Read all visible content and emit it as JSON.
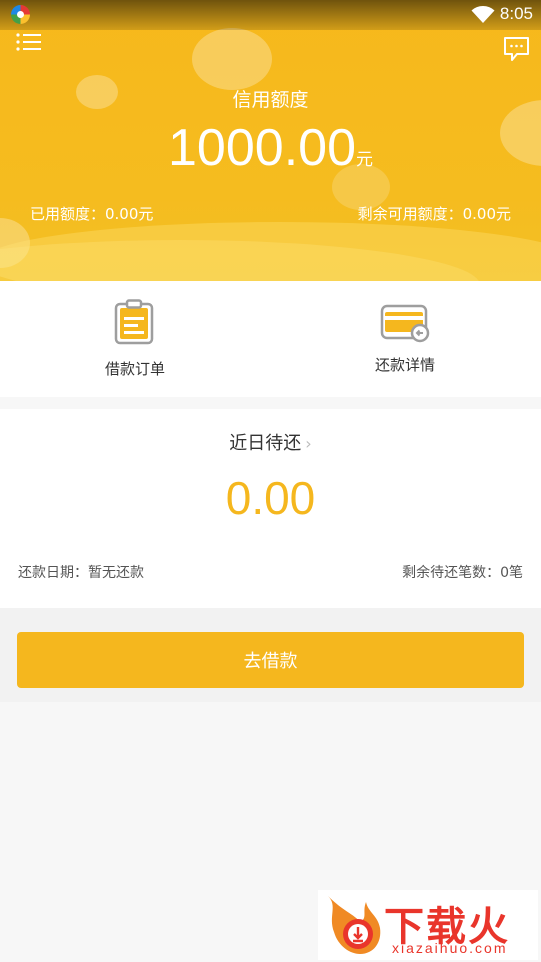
{
  "status_bar": {
    "time": "8:05"
  },
  "header": {
    "credit_label": "信用额度",
    "credit_amount": "1000.00",
    "credit_unit": "元",
    "used_credit": "已用额度：0.00元",
    "remaining_credit": "剩余可用额度：0.00元"
  },
  "actions": [
    {
      "label": "借款订单",
      "icon": "clipboard-icon"
    },
    {
      "label": "还款详情",
      "icon": "card-icon"
    }
  ],
  "repayment": {
    "title": "近日待还",
    "chevron": "›",
    "amount": "0.00",
    "date_text": "还款日期：暂无还款",
    "count_text": "剩余待还笔数：0笔"
  },
  "borrow_button": {
    "label": "去借款"
  },
  "watermark": {
    "text": "下载火",
    "url": "xiazaihuo.com"
  },
  "colors": {
    "accent": "#f5b71e",
    "header": "#f7b81c",
    "watermark": "#e9352b"
  }
}
